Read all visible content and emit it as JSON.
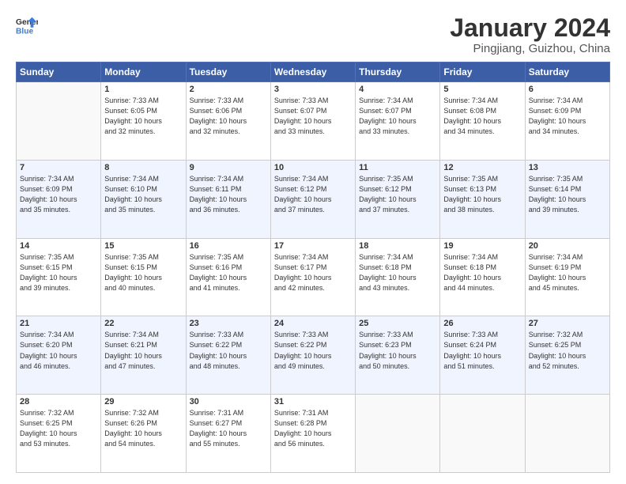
{
  "header": {
    "logo_line1": "General",
    "logo_line2": "Blue",
    "title": "January 2024",
    "subtitle": "Pingjiang, Guizhou, China"
  },
  "weekdays": [
    "Sunday",
    "Monday",
    "Tuesday",
    "Wednesday",
    "Thursday",
    "Friday",
    "Saturday"
  ],
  "weeks": [
    [
      {
        "day": "",
        "info": ""
      },
      {
        "day": "1",
        "info": "Sunrise: 7:33 AM\nSunset: 6:05 PM\nDaylight: 10 hours\nand 32 minutes."
      },
      {
        "day": "2",
        "info": "Sunrise: 7:33 AM\nSunset: 6:06 PM\nDaylight: 10 hours\nand 32 minutes."
      },
      {
        "day": "3",
        "info": "Sunrise: 7:33 AM\nSunset: 6:07 PM\nDaylight: 10 hours\nand 33 minutes."
      },
      {
        "day": "4",
        "info": "Sunrise: 7:34 AM\nSunset: 6:07 PM\nDaylight: 10 hours\nand 33 minutes."
      },
      {
        "day": "5",
        "info": "Sunrise: 7:34 AM\nSunset: 6:08 PM\nDaylight: 10 hours\nand 34 minutes."
      },
      {
        "day": "6",
        "info": "Sunrise: 7:34 AM\nSunset: 6:09 PM\nDaylight: 10 hours\nand 34 minutes."
      }
    ],
    [
      {
        "day": "7",
        "info": "Sunrise: 7:34 AM\nSunset: 6:09 PM\nDaylight: 10 hours\nand 35 minutes."
      },
      {
        "day": "8",
        "info": "Sunrise: 7:34 AM\nSunset: 6:10 PM\nDaylight: 10 hours\nand 35 minutes."
      },
      {
        "day": "9",
        "info": "Sunrise: 7:34 AM\nSunset: 6:11 PM\nDaylight: 10 hours\nand 36 minutes."
      },
      {
        "day": "10",
        "info": "Sunrise: 7:34 AM\nSunset: 6:12 PM\nDaylight: 10 hours\nand 37 minutes."
      },
      {
        "day": "11",
        "info": "Sunrise: 7:35 AM\nSunset: 6:12 PM\nDaylight: 10 hours\nand 37 minutes."
      },
      {
        "day": "12",
        "info": "Sunrise: 7:35 AM\nSunset: 6:13 PM\nDaylight: 10 hours\nand 38 minutes."
      },
      {
        "day": "13",
        "info": "Sunrise: 7:35 AM\nSunset: 6:14 PM\nDaylight: 10 hours\nand 39 minutes."
      }
    ],
    [
      {
        "day": "14",
        "info": "Sunrise: 7:35 AM\nSunset: 6:15 PM\nDaylight: 10 hours\nand 39 minutes."
      },
      {
        "day": "15",
        "info": "Sunrise: 7:35 AM\nSunset: 6:15 PM\nDaylight: 10 hours\nand 40 minutes."
      },
      {
        "day": "16",
        "info": "Sunrise: 7:35 AM\nSunset: 6:16 PM\nDaylight: 10 hours\nand 41 minutes."
      },
      {
        "day": "17",
        "info": "Sunrise: 7:34 AM\nSunset: 6:17 PM\nDaylight: 10 hours\nand 42 minutes."
      },
      {
        "day": "18",
        "info": "Sunrise: 7:34 AM\nSunset: 6:18 PM\nDaylight: 10 hours\nand 43 minutes."
      },
      {
        "day": "19",
        "info": "Sunrise: 7:34 AM\nSunset: 6:18 PM\nDaylight: 10 hours\nand 44 minutes."
      },
      {
        "day": "20",
        "info": "Sunrise: 7:34 AM\nSunset: 6:19 PM\nDaylight: 10 hours\nand 45 minutes."
      }
    ],
    [
      {
        "day": "21",
        "info": "Sunrise: 7:34 AM\nSunset: 6:20 PM\nDaylight: 10 hours\nand 46 minutes."
      },
      {
        "day": "22",
        "info": "Sunrise: 7:34 AM\nSunset: 6:21 PM\nDaylight: 10 hours\nand 47 minutes."
      },
      {
        "day": "23",
        "info": "Sunrise: 7:33 AM\nSunset: 6:22 PM\nDaylight: 10 hours\nand 48 minutes."
      },
      {
        "day": "24",
        "info": "Sunrise: 7:33 AM\nSunset: 6:22 PM\nDaylight: 10 hours\nand 49 minutes."
      },
      {
        "day": "25",
        "info": "Sunrise: 7:33 AM\nSunset: 6:23 PM\nDaylight: 10 hours\nand 50 minutes."
      },
      {
        "day": "26",
        "info": "Sunrise: 7:33 AM\nSunset: 6:24 PM\nDaylight: 10 hours\nand 51 minutes."
      },
      {
        "day": "27",
        "info": "Sunrise: 7:32 AM\nSunset: 6:25 PM\nDaylight: 10 hours\nand 52 minutes."
      }
    ],
    [
      {
        "day": "28",
        "info": "Sunrise: 7:32 AM\nSunset: 6:25 PM\nDaylight: 10 hours\nand 53 minutes."
      },
      {
        "day": "29",
        "info": "Sunrise: 7:32 AM\nSunset: 6:26 PM\nDaylight: 10 hours\nand 54 minutes."
      },
      {
        "day": "30",
        "info": "Sunrise: 7:31 AM\nSunset: 6:27 PM\nDaylight: 10 hours\nand 55 minutes."
      },
      {
        "day": "31",
        "info": "Sunrise: 7:31 AM\nSunset: 6:28 PM\nDaylight: 10 hours\nand 56 minutes."
      },
      {
        "day": "",
        "info": ""
      },
      {
        "day": "",
        "info": ""
      },
      {
        "day": "",
        "info": ""
      }
    ]
  ]
}
